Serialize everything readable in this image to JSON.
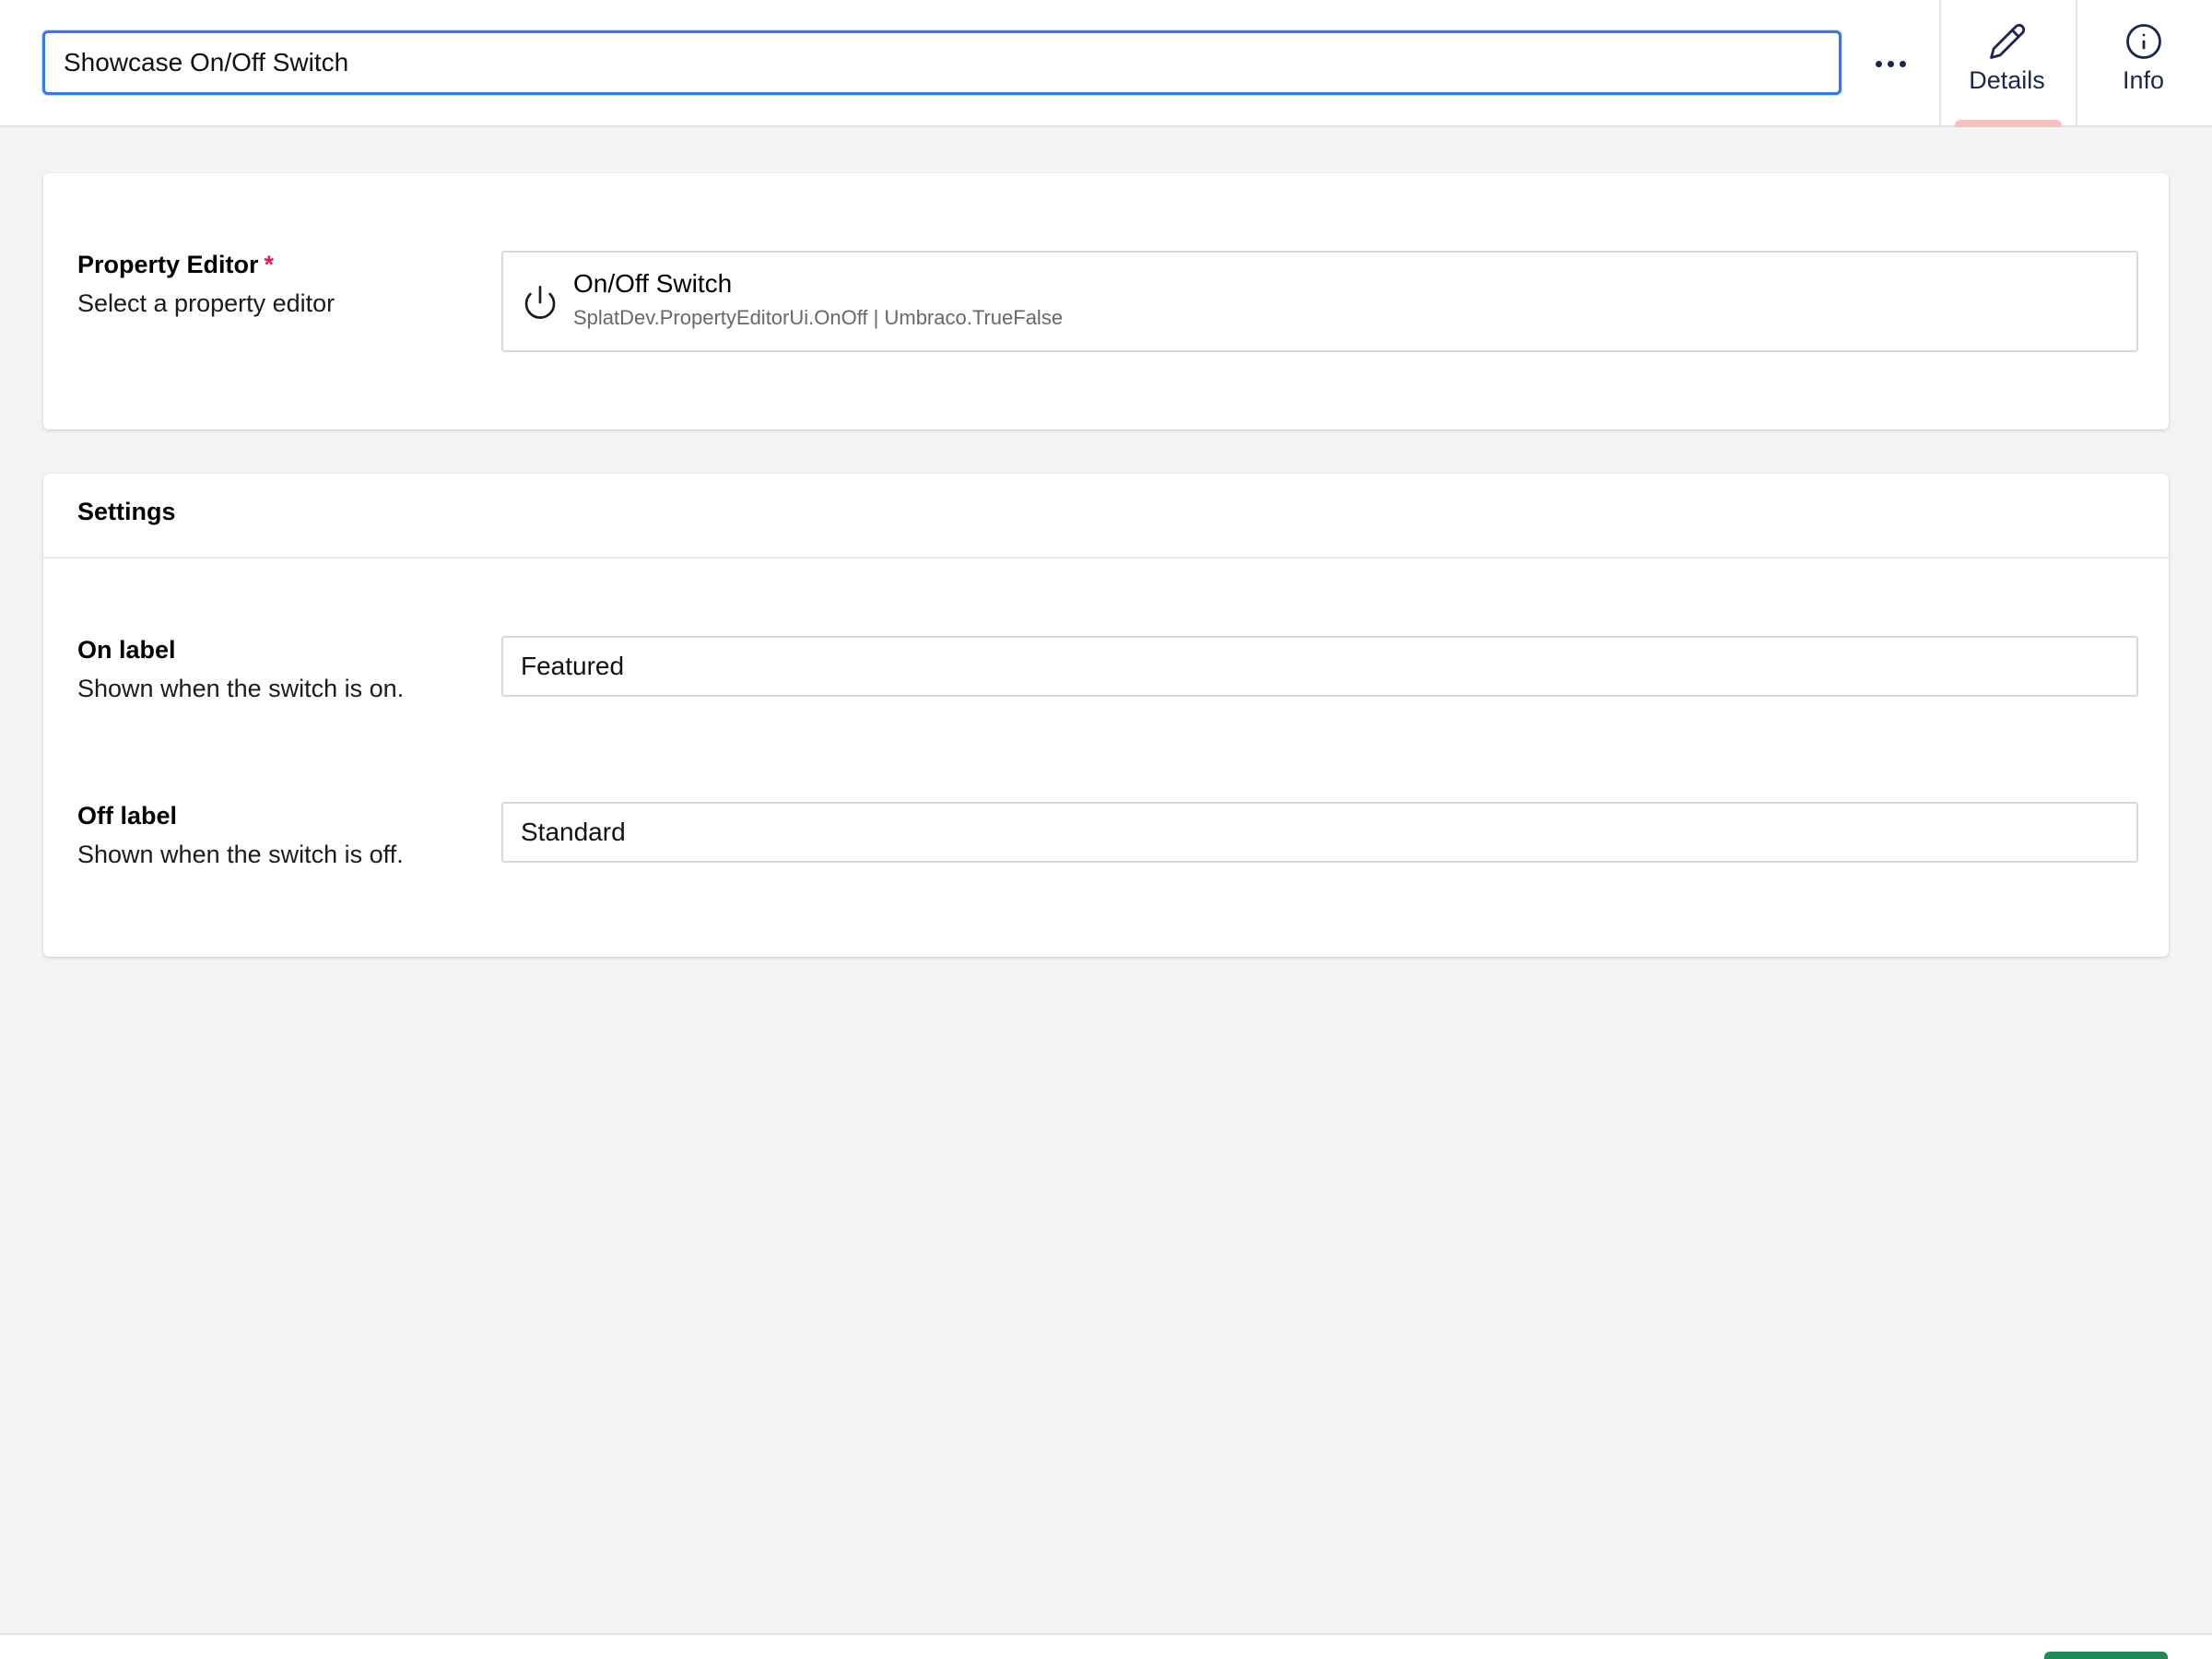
{
  "header": {
    "name_value": "Showcase On/Off Switch",
    "more_actions": "more-horizontal-icon",
    "tabs": [
      {
        "label": "Details",
        "icon": "pencil-icon",
        "active": true
      },
      {
        "label": "Info",
        "icon": "info-icon",
        "active": false
      }
    ],
    "active_tab_color": "#f5c1bc",
    "focus_color": "#3879e8"
  },
  "editor_card": {
    "label": "Property Editor",
    "required_marker": "*",
    "description": "Select a property editor",
    "selected_editor": {
      "icon": "power-icon",
      "name": "On/Off Switch",
      "alias": "SplatDev.PropertyEditorUi.OnOff | Umbraco.TrueFalse"
    }
  },
  "settings": {
    "title": "Settings",
    "fields": [
      {
        "label": "On label",
        "description": "Shown when the switch is on.",
        "value": "Featured"
      },
      {
        "label": "Off label",
        "description": "Shown when the switch is off.",
        "value": "Standard"
      }
    ]
  },
  "colors": {
    "background": "#f3f3f5",
    "required": "#d42054",
    "save_button": "#1f8a56"
  }
}
